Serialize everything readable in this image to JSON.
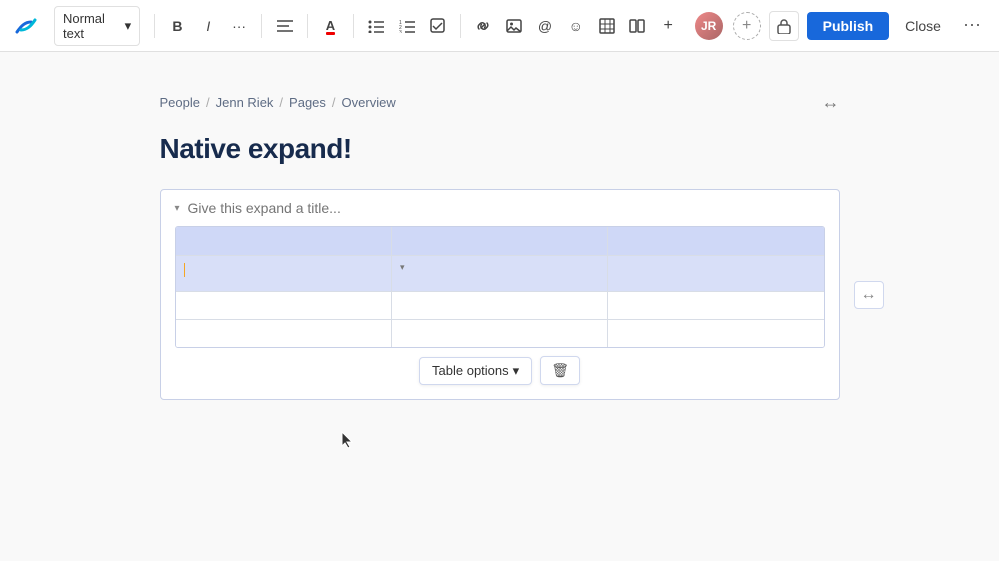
{
  "toolbar": {
    "logo_alt": "Confluence logo",
    "style_select": "Normal text",
    "bold_label": "B",
    "italic_label": "I",
    "more_format_label": "···",
    "align_label": "≡",
    "text_color_label": "A",
    "bullet_list_label": "•≡",
    "number_list_label": "1≡",
    "task_label": "☑",
    "link_label": "🔗",
    "image_label": "🖼",
    "mention_label": "@",
    "emoji_label": "☺",
    "table_label": "⊞",
    "column_label": "⫿",
    "insert_more_label": "+",
    "add_collaborator_label": "+",
    "publish_label": "Publish",
    "close_label": "Close",
    "more_options_label": "⋯"
  },
  "breadcrumb": {
    "items": [
      {
        "label": "People",
        "id": "people"
      },
      {
        "label": "Jenn Riek",
        "id": "jenn-riek"
      },
      {
        "label": "Pages",
        "id": "pages"
      },
      {
        "label": "Overview",
        "id": "overview"
      }
    ],
    "separator": "/"
  },
  "page": {
    "title": "Native expand!"
  },
  "expand_block": {
    "placeholder": "Give this expand a title...",
    "chevron": "▾"
  },
  "table": {
    "rows": [
      [
        "",
        "",
        ""
      ],
      [
        "",
        "",
        ""
      ],
      [
        "",
        "",
        ""
      ],
      [
        "",
        "",
        ""
      ]
    ]
  },
  "table_options": {
    "label": "Table options",
    "chevron": "▾",
    "delete_icon": "🗑"
  },
  "expand_width": {
    "icon": "↔"
  }
}
